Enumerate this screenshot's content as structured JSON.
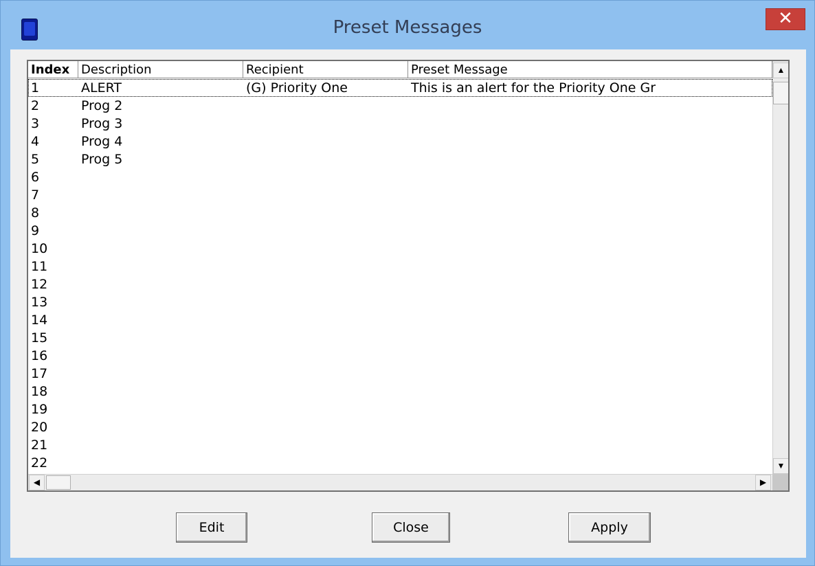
{
  "window": {
    "title": "Preset Messages",
    "close_glyph": "✕",
    "app_icon": "device-icon"
  },
  "table": {
    "columns": [
      "Index",
      "Description",
      "Recipient",
      "Preset Message"
    ],
    "rows": [
      {
        "index": "1",
        "description": "ALERT",
        "recipient": "(G) Priority One",
        "message": "This is an alert for the Priority One Gr"
      },
      {
        "index": "2",
        "description": "Prog 2",
        "recipient": "",
        "message": ""
      },
      {
        "index": "3",
        "description": "Prog 3",
        "recipient": "",
        "message": ""
      },
      {
        "index": "4",
        "description": "Prog 4",
        "recipient": "",
        "message": ""
      },
      {
        "index": "5",
        "description": "Prog 5",
        "recipient": "",
        "message": ""
      },
      {
        "index": "6",
        "description": "",
        "recipient": "",
        "message": ""
      },
      {
        "index": "7",
        "description": "",
        "recipient": "",
        "message": ""
      },
      {
        "index": "8",
        "description": "",
        "recipient": "",
        "message": ""
      },
      {
        "index": "9",
        "description": "",
        "recipient": "",
        "message": ""
      },
      {
        "index": "10",
        "description": "",
        "recipient": "",
        "message": ""
      },
      {
        "index": "11",
        "description": "",
        "recipient": "",
        "message": ""
      },
      {
        "index": "12",
        "description": "",
        "recipient": "",
        "message": ""
      },
      {
        "index": "13",
        "description": "",
        "recipient": "",
        "message": ""
      },
      {
        "index": "14",
        "description": "",
        "recipient": "",
        "message": ""
      },
      {
        "index": "15",
        "description": "",
        "recipient": "",
        "message": ""
      },
      {
        "index": "16",
        "description": "",
        "recipient": "",
        "message": ""
      },
      {
        "index": "17",
        "description": "",
        "recipient": "",
        "message": ""
      },
      {
        "index": "18",
        "description": "",
        "recipient": "",
        "message": ""
      },
      {
        "index": "19",
        "description": "",
        "recipient": "",
        "message": ""
      },
      {
        "index": "20",
        "description": "",
        "recipient": "",
        "message": ""
      },
      {
        "index": "21",
        "description": "",
        "recipient": "",
        "message": ""
      },
      {
        "index": "22",
        "description": "",
        "recipient": "",
        "message": ""
      }
    ],
    "selected_row": "1"
  },
  "scrollbar": {
    "up": "▲",
    "down": "▼",
    "left": "◀",
    "right": "▶"
  },
  "buttons": {
    "edit": "Edit",
    "close": "Close",
    "apply": "Apply"
  }
}
